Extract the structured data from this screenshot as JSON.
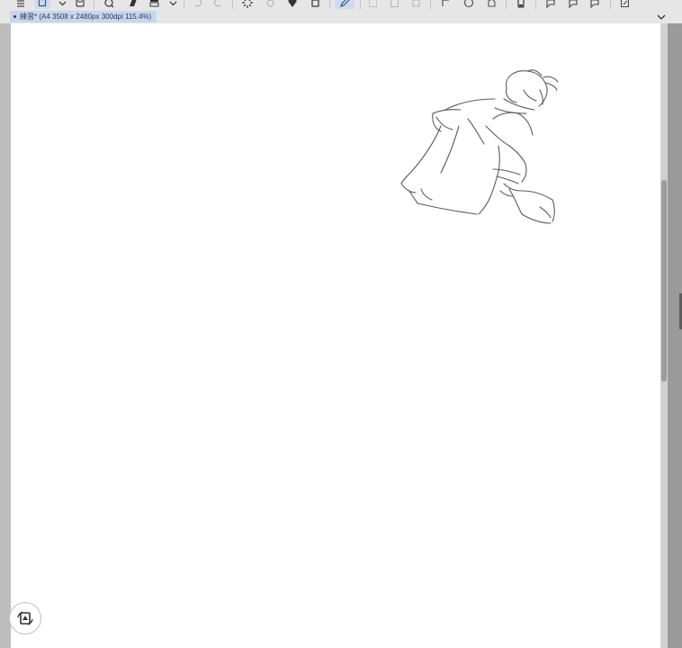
{
  "toolbar": {
    "icons": [
      "menu-icon",
      "canvas-icon",
      "chevron-down-icon",
      "save-icon",
      "new-layer-icon",
      "fill-icon",
      "layer-stack-icon",
      "chevron-down-icon",
      "undo-icon",
      "redo-icon",
      "loading-spinner-icon",
      "settings-icon",
      "pen-nib-icon",
      "crop-icon",
      "pen-tool-icon",
      "selection-icon",
      "transform-icon",
      "copy-icon",
      "deselect-icon",
      "lasso-icon",
      "edit-icon",
      "phone-icon",
      "speech-icon",
      "speech-icon",
      "speech-icon",
      "export-icon"
    ]
  },
  "document": {
    "tab_title": "練習* (A4 3508 x 2480px 300dpi 115.4%)"
  },
  "colors": {
    "canvas": "#ffffff",
    "workspace": "#bdbdbd",
    "tab_active": "#c6d6ee",
    "sketch_stroke": "#5a5a5a"
  },
  "canvas": {
    "rotate_button_icon": "rotate-canvas-icon"
  }
}
